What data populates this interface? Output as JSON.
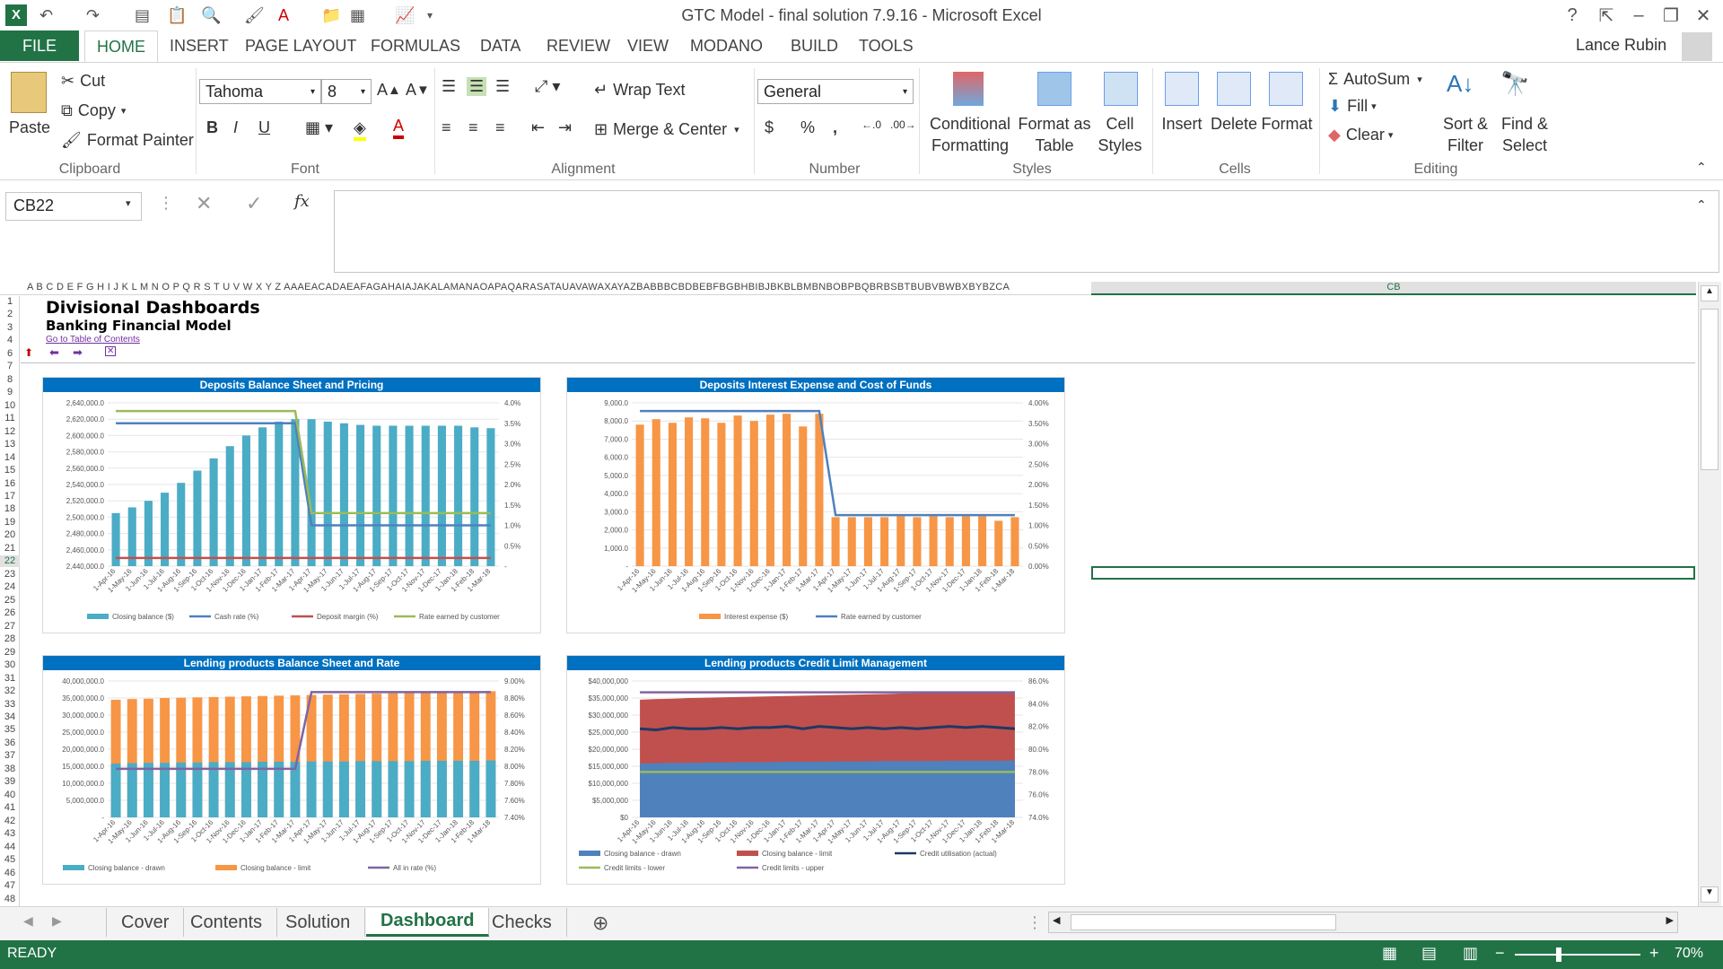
{
  "window": {
    "title": "GTC Model - final solution 7.9.16 - Microsoft Excel",
    "user": "Lance Rubin"
  },
  "ribbon_tabs": [
    "FILE",
    "HOME",
    "INSERT",
    "PAGE LAYOUT",
    "FORMULAS",
    "DATA",
    "REVIEW",
    "VIEW",
    "MODANO",
    "BUILD",
    "TOOLS"
  ],
  "clipboard": {
    "paste": "Paste",
    "cut": "Cut",
    "copy": "Copy",
    "format_painter": "Format Painter",
    "label": "Clipboard"
  },
  "font": {
    "name": "Tahoma",
    "size": "8",
    "label": "Font",
    "bold": "B",
    "italic": "I",
    "underline": "U"
  },
  "alignment": {
    "wrap": "Wrap Text",
    "merge": "Merge & Center",
    "label": "Alignment"
  },
  "number": {
    "format": "General",
    "label": "Number",
    "currency": "$",
    "percent": "%",
    "comma": ","
  },
  "styles": {
    "cond": "Conditional",
    "cond2": "Formatting",
    "fat": "Format as",
    "fat2": "Table",
    "cell": "Cell",
    "cell2": "Styles",
    "label": "Styles"
  },
  "cells": {
    "insert": "Insert",
    "delete": "Delete",
    "format": "Format",
    "label": "Cells"
  },
  "editing": {
    "autosum": "AutoSum",
    "fill": "Fill",
    "clear": "Clear",
    "sort": "Sort &",
    "sort2": "Filter",
    "find": "Find &",
    "find2": "Select",
    "label": "Editing"
  },
  "namebox": "CB22",
  "column_headers": "A B C D E F G H I J K L M N O P Q R S T U V W X Y Z AAAEACADAEAFAGAHAIAJAKALAMANAOAPAQARASATAUAVAWAXAYAZBABBBCBDBEBFBGBHBIBJBKBLBMBNBOBPBQBRBSBTBUBVBWBXBYBZCA",
  "selected_column": "CB",
  "rows": [
    "1",
    "2",
    "3",
    "4",
    "6",
    "7",
    "8",
    "9",
    "10",
    "11",
    "12",
    "13",
    "14",
    "15",
    "16",
    "17",
    "18",
    "19",
    "20",
    "21",
    "22",
    "23",
    "24",
    "25",
    "26",
    "27",
    "28",
    "29",
    "30",
    "31",
    "32",
    "33",
    "34",
    "35",
    "36",
    "37",
    "38",
    "39",
    "40",
    "41",
    "42",
    "43",
    "44",
    "45",
    "46",
    "47",
    "48"
  ],
  "sheet": {
    "title": "Divisional Dashboards",
    "subtitle": "Banking Financial Model",
    "link": "Go to Table of Contents"
  },
  "chart_data": [
    {
      "type": "bar",
      "title": "Deposits Balance Sheet and Pricing",
      "categories": [
        "1-Apr-16",
        "1-May-16",
        "1-Jun-16",
        "1-Jul-16",
        "1-Aug-16",
        "1-Sep-16",
        "1-Oct-16",
        "1-Nov-16",
        "1-Dec-16",
        "1-Jan-17",
        "1-Feb-17",
        "1-Mar-17",
        "1-Apr-17",
        "1-May-17",
        "1-Jun-17",
        "1-Jul-17",
        "1-Aug-17",
        "1-Sep-17",
        "1-Oct-17",
        "1-Nov-17",
        "1-Dec-17",
        "1-Jan-18",
        "1-Feb-18",
        "1-Mar-18"
      ],
      "yticks": [
        "2,640,000.0",
        "2,620,000.0",
        "2,600,000.0",
        "2,580,000.0",
        "2,560,000.0",
        "2,540,000.0",
        "2,520,000.0",
        "2,500,000.0",
        "2,480,000.0",
        "2,460,000.0",
        "2,440,000.0"
      ],
      "y2ticks": [
        "4.0%",
        "3.5%",
        "3.0%",
        "2.5%",
        "2.0%",
        "1.5%",
        "1.0%",
        "0.5%",
        "-"
      ],
      "ylim": [
        2440000,
        2640000
      ],
      "y2lim": [
        0,
        4
      ],
      "series": [
        {
          "name": "Closing balance ($)",
          "kind": "bar",
          "axis": "y",
          "values": [
            2505000,
            2512000,
            2520000,
            2530000,
            2542000,
            2557000,
            2572000,
            2587000,
            2600000,
            2610000,
            2617000,
            2620000,
            2620000,
            2617000,
            2615000,
            2613000,
            2612000,
            2612000,
            2612000,
            2612000,
            2612000,
            2612000,
            2610000,
            2609000
          ]
        },
        {
          "name": "Cash rate (%)",
          "kind": "line",
          "axis": "y2",
          "values": [
            3.5,
            3.5,
            3.5,
            3.5,
            3.5,
            3.5,
            3.5,
            3.5,
            3.5,
            3.5,
            3.5,
            3.5,
            1.0,
            1.0,
            1.0,
            1.0,
            1.0,
            1.0,
            1.0,
            1.0,
            1.0,
            1.0,
            1.0,
            1.0
          ]
        },
        {
          "name": "Deposit margin (%)",
          "kind": "line",
          "axis": "y2",
          "values": [
            0.2,
            0.2,
            0.2,
            0.2,
            0.2,
            0.2,
            0.2,
            0.2,
            0.2,
            0.2,
            0.2,
            0.2,
            0.2,
            0.2,
            0.2,
            0.2,
            0.2,
            0.2,
            0.2,
            0.2,
            0.2,
            0.2,
            0.2,
            0.2
          ]
        },
        {
          "name": "Rate earned by customer",
          "kind": "line",
          "axis": "y2",
          "values": [
            3.8,
            3.8,
            3.8,
            3.8,
            3.8,
            3.8,
            3.8,
            3.8,
            3.8,
            3.8,
            3.8,
            3.8,
            1.3,
            1.3,
            1.3,
            1.3,
            1.3,
            1.3,
            1.3,
            1.3,
            1.3,
            1.3,
            1.3,
            1.3
          ]
        }
      ]
    },
    {
      "type": "bar",
      "title": "Deposits Interest Expense and Cost of Funds",
      "categories": [
        "1-Apr-16",
        "1-May-16",
        "1-Jun-16",
        "1-Jul-16",
        "1-Aug-16",
        "1-Sep-16",
        "1-Oct-16",
        "1-Nov-16",
        "1-Dec-16",
        "1-Jan-17",
        "1-Feb-17",
        "1-Mar-17",
        "1-Apr-17",
        "1-May-17",
        "1-Jun-17",
        "1-Jul-17",
        "1-Aug-17",
        "1-Sep-17",
        "1-Oct-17",
        "1-Nov-17",
        "1-Dec-17",
        "1-Jan-18",
        "1-Feb-18",
        "1-Mar-18"
      ],
      "yticks": [
        "9,000.0",
        "8,000.0",
        "7,000.0",
        "6,000.0",
        "5,000.0",
        "4,000.0",
        "3,000.0",
        "2,000.0",
        "1,000.0",
        "-"
      ],
      "y2ticks": [
        "4.00%",
        "3.50%",
        "3.00%",
        "2.50%",
        "2.00%",
        "1.50%",
        "1.00%",
        "0.50%",
        "0.00%"
      ],
      "ylim": [
        0,
        9000
      ],
      "y2lim": [
        0,
        4
      ],
      "series": [
        {
          "name": "Interest expense ($)",
          "kind": "bar",
          "axis": "y",
          "values": [
            7800,
            8100,
            7900,
            8200,
            8150,
            7900,
            8300,
            8000,
            8350,
            8400,
            7700,
            8400,
            2700,
            2700,
            2700,
            2700,
            2750,
            2700,
            2750,
            2700,
            2750,
            2750,
            2500,
            2700
          ]
        },
        {
          "name": "Rate earned by customer",
          "kind": "line",
          "axis": "y2",
          "values": [
            3.8,
            3.8,
            3.8,
            3.8,
            3.8,
            3.8,
            3.8,
            3.8,
            3.8,
            3.8,
            3.8,
            3.8,
            1.25,
            1.25,
            1.25,
            1.25,
            1.25,
            1.25,
            1.25,
            1.25,
            1.25,
            1.25,
            1.25,
            1.25
          ]
        }
      ]
    },
    {
      "type": "bar",
      "title": "Lending products Balance Sheet and Rate",
      "categories": [
        "1-Apr-16",
        "1-May-16",
        "1-Jun-16",
        "1-Jul-16",
        "1-Aug-16",
        "1-Sep-16",
        "1-Oct-16",
        "1-Nov-16",
        "1-Dec-16",
        "1-Jan-17",
        "1-Feb-17",
        "1-Mar-17",
        "1-Apr-17",
        "1-May-17",
        "1-Jun-17",
        "1-Jul-17",
        "1-Aug-17",
        "1-Sep-17",
        "1-Oct-17",
        "1-Nov-17",
        "1-Dec-17",
        "1-Jan-18",
        "1-Feb-18",
        "1-Mar-18"
      ],
      "yticks": [
        "40,000,000.0",
        "35,000,000.0",
        "30,000,000.0",
        "25,000,000.0",
        "20,000,000.0",
        "15,000,000.0",
        "10,000,000.0",
        "5,000,000.0",
        "-"
      ],
      "y2ticks": [
        "9.00%",
        "8.80%",
        "8.60%",
        "8.40%",
        "8.20%",
        "8.00%",
        "7.80%",
        "7.60%",
        "7.40%"
      ],
      "ylim": [
        0,
        40000000
      ],
      "y2lim": [
        7.4,
        9.0
      ],
      "series": [
        {
          "name": "Closing balance - drawn",
          "kind": "bar",
          "axis": "y",
          "values": [
            15800000,
            15900000,
            16000000,
            16000000,
            16100000,
            16100000,
            16200000,
            16200000,
            16200000,
            16300000,
            16300000,
            16300000,
            16400000,
            16400000,
            16400000,
            16500000,
            16500000,
            16500000,
            16500000,
            16600000,
            16600000,
            16600000,
            16600000,
            16700000
          ]
        },
        {
          "name": "Closing balance - limit",
          "kind": "bar",
          "axis": "y",
          "values": [
            34500000,
            34700000,
            34800000,
            35000000,
            35100000,
            35200000,
            35300000,
            35400000,
            35500000,
            35600000,
            35700000,
            35800000,
            35900000,
            36000000,
            36100000,
            36200000,
            36300000,
            36400000,
            36500000,
            36600000,
            36700000,
            36800000,
            36900000,
            37000000
          ]
        },
        {
          "name": "All in rate (%)",
          "kind": "line",
          "axis": "y2",
          "values": [
            7.97,
            7.97,
            7.97,
            7.97,
            7.97,
            7.97,
            7.97,
            7.97,
            7.97,
            7.97,
            7.97,
            7.97,
            8.87,
            8.87,
            8.87,
            8.87,
            8.87,
            8.87,
            8.87,
            8.87,
            8.87,
            8.87,
            8.87,
            8.87
          ]
        }
      ]
    },
    {
      "type": "area",
      "title": "Lending products Credit Limit Management",
      "categories": [
        "1-Apr-16",
        "1-May-16",
        "1-Jun-16",
        "1-Jul-16",
        "1-Aug-16",
        "1-Sep-16",
        "1-Oct-16",
        "1-Nov-16",
        "1-Dec-16",
        "1-Jan-17",
        "1-Feb-17",
        "1-Mar-17",
        "1-Apr-17",
        "1-May-17",
        "1-Jun-17",
        "1-Jul-17",
        "1-Aug-17",
        "1-Sep-17",
        "1-Oct-17",
        "1-Nov-17",
        "1-Dec-17",
        "1-Jan-18",
        "1-Feb-18",
        "1-Mar-18"
      ],
      "yticks": [
        "$40,000,000",
        "$35,000,000",
        "$30,000,000",
        "$25,000,000",
        "$20,000,000",
        "$15,000,000",
        "$10,000,000",
        "$5,000,000",
        "$0"
      ],
      "y2ticks": [
        "86.0%",
        "84.0%",
        "82.0%",
        "80.0%",
        "78.0%",
        "76.0%",
        "74.0%"
      ],
      "ylim": [
        0,
        40000000
      ],
      "y2lim": [
        74,
        86
      ],
      "series": [
        {
          "name": "Closing balance - drawn",
          "kind": "area",
          "axis": "y",
          "values": [
            15800000,
            15900000,
            16000000,
            16000000,
            16100000,
            16100000,
            16200000,
            16200000,
            16200000,
            16300000,
            16300000,
            16300000,
            16400000,
            16400000,
            16400000,
            16500000,
            16500000,
            16500000,
            16500000,
            16600000,
            16600000,
            16600000,
            16600000,
            16700000
          ]
        },
        {
          "name": "Closing balance - limit",
          "kind": "area",
          "axis": "y",
          "values": [
            34500000,
            34700000,
            34800000,
            35000000,
            35100000,
            35200000,
            35300000,
            35400000,
            35500000,
            35600000,
            35700000,
            35800000,
            35900000,
            36000000,
            36100000,
            36200000,
            36300000,
            36400000,
            36500000,
            36600000,
            36700000,
            36800000,
            36900000,
            37000000
          ]
        },
        {
          "name": "Credit utilisation (actual)",
          "kind": "line",
          "axis": "y2",
          "values": [
            81.8,
            81.7,
            81.9,
            81.8,
            81.8,
            81.9,
            81.8,
            81.9,
            81.9,
            82.0,
            81.8,
            82.0,
            81.9,
            81.8,
            81.9,
            81.8,
            81.9,
            81.8,
            81.9,
            82.0,
            81.9,
            82.0,
            81.9,
            81.8
          ]
        },
        {
          "name": "Credit limits - lower",
          "kind": "line",
          "axis": "y2",
          "values": [
            78,
            78,
            78,
            78,
            78,
            78,
            78,
            78,
            78,
            78,
            78,
            78,
            78,
            78,
            78,
            78,
            78,
            78,
            78,
            78,
            78,
            78,
            78,
            78
          ]
        },
        {
          "name": "Credit limits - upper",
          "kind": "line",
          "axis": "y2",
          "values": [
            85,
            85,
            85,
            85,
            85,
            85,
            85,
            85,
            85,
            85,
            85,
            85,
            85,
            85,
            85,
            85,
            85,
            85,
            85,
            85,
            85,
            85,
            85,
            85
          ]
        }
      ]
    }
  ],
  "sheet_tabs": [
    "Cover",
    "Contents",
    "Solution",
    "Dashboard",
    "Checks"
  ],
  "active_sheet": "Dashboard",
  "status": {
    "mode": "READY",
    "zoom": "70%"
  },
  "colors": {
    "excel_green": "#217346",
    "chart_title": "#0070c0",
    "teal": "#4bacc6",
    "orange": "#f79646",
    "blue": "#4f81bd",
    "red": "#c0504d",
    "green": "#9bbb59",
    "navy": "#1f3864",
    "purple": "#8064a2"
  }
}
